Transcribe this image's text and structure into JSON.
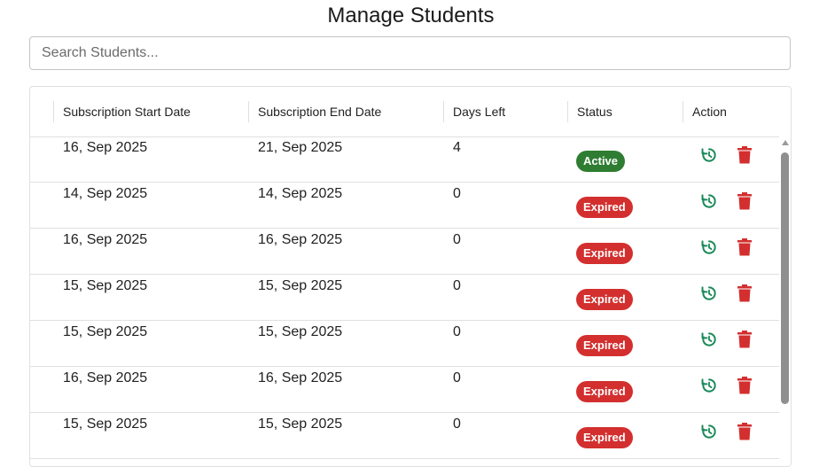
{
  "page": {
    "title": "Manage Students"
  },
  "search": {
    "placeholder": "Search Students...",
    "value": ""
  },
  "table": {
    "columns": [
      "Subscription Start Date",
      "Subscription End Date",
      "Days Left",
      "Status",
      "Action"
    ],
    "rows": [
      {
        "start": "16, Sep 2025",
        "end": "21, Sep 2025",
        "days_left": "4",
        "status": "Active"
      },
      {
        "start": "14, Sep 2025",
        "end": "14, Sep 2025",
        "days_left": "0",
        "status": "Expired"
      },
      {
        "start": "16, Sep 2025",
        "end": "16, Sep 2025",
        "days_left": "0",
        "status": "Expired"
      },
      {
        "start": "15, Sep 2025",
        "end": "15, Sep 2025",
        "days_left": "0",
        "status": "Expired"
      },
      {
        "start": "15, Sep 2025",
        "end": "15, Sep 2025",
        "days_left": "0",
        "status": "Expired"
      },
      {
        "start": "16, Sep 2025",
        "end": "16, Sep 2025",
        "days_left": "0",
        "status": "Expired"
      },
      {
        "start": "15, Sep 2025",
        "end": "15, Sep 2025",
        "days_left": "0",
        "status": "Expired"
      }
    ],
    "actions": {
      "renew_icon": "renew-icon",
      "delete_icon": "trash-icon"
    }
  },
  "colors": {
    "active": "#2e7d32",
    "expired": "#d32f2f",
    "renew_icon": "#1b8a5a",
    "delete_icon": "#d32f2f"
  }
}
